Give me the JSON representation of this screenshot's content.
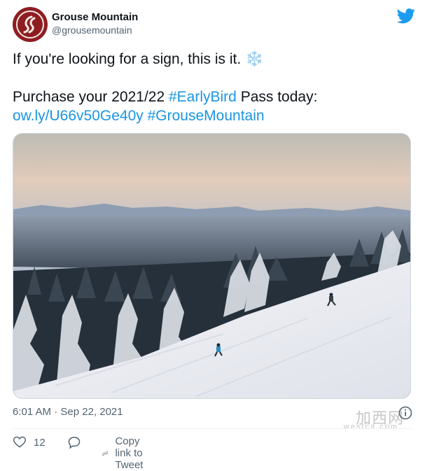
{
  "tweet": {
    "author": {
      "name": "Grouse Mountain",
      "handle": "@grousemountain"
    },
    "text": {
      "line1": "If you're looking for a sign, this is it. ❄️",
      "line2_prefix": "Purchase your 2021/22 ",
      "line2_hashtag": "#EarlyBird",
      "line2_suffix": " Pass today:",
      "line3_link": "ow.ly/U66v50Ge40y",
      "line3_hashtag": "#GrouseMountain"
    },
    "timestamp": "6:01 AM · Sep 22, 2021",
    "likes": "12",
    "copy_link_label": "Copy link to Tweet"
  },
  "watermark": {
    "main": "加西网",
    "sub": "westca.com"
  },
  "colors": {
    "link": "#1b95e0",
    "brand": "#8e1d22",
    "twitter_blue": "#1d9bf0",
    "muted": "#536471"
  },
  "icons": [
    "twitter-bird-icon",
    "info-icon",
    "heart-icon",
    "reply-icon",
    "link-icon"
  ]
}
